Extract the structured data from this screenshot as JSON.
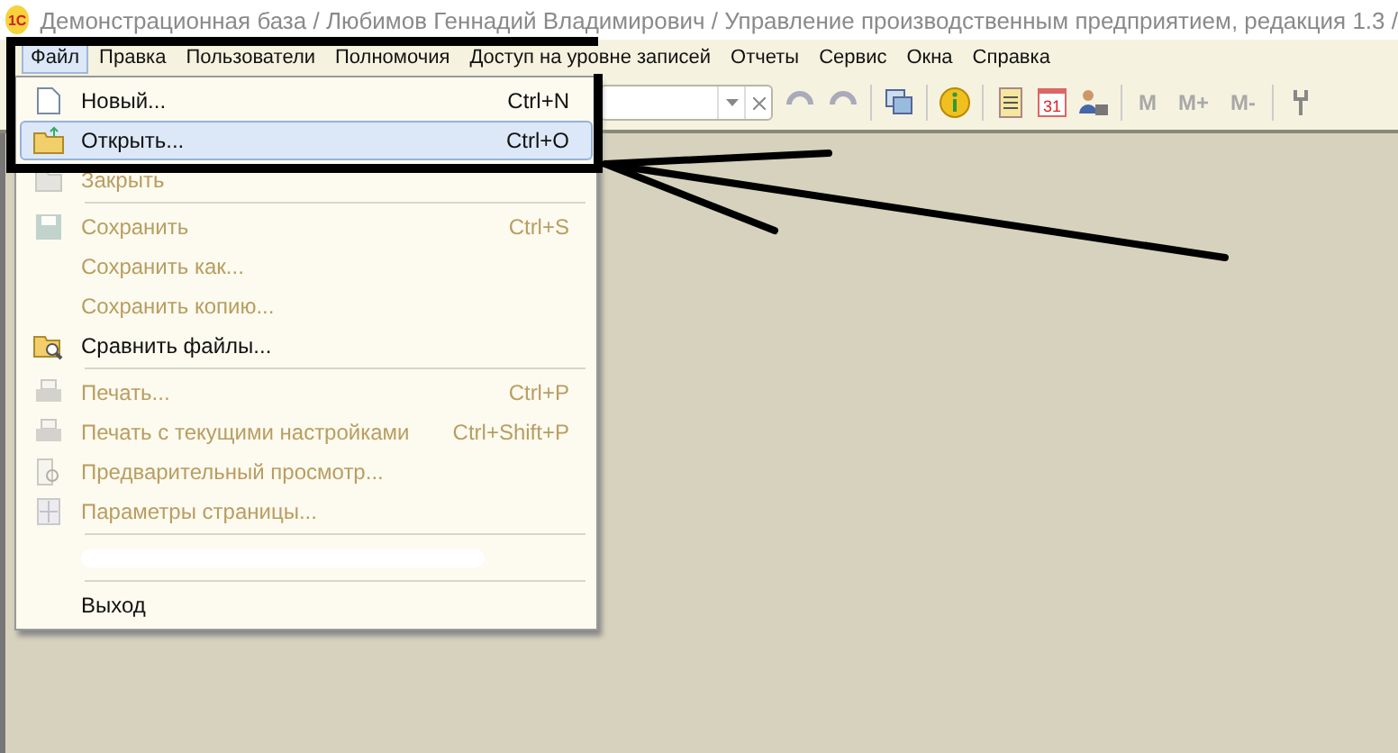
{
  "window": {
    "logo_text": "1С",
    "title": "Демонстрационная база / Любимов Геннадий Владимирович /  Управление производственным предприятием, редакция 1.3 /"
  },
  "menu_bar": [
    {
      "label": "Файл",
      "selected": true
    },
    {
      "label": "Правка",
      "selected": false
    },
    {
      "label": "Пользователи",
      "selected": false
    },
    {
      "label": "Полномочия",
      "selected": false
    },
    {
      "label": "Доступ на уровне записей",
      "selected": false
    },
    {
      "label": "Отчеты",
      "selected": false
    },
    {
      "label": "Сервис",
      "selected": false
    },
    {
      "label": "Окна",
      "selected": false
    },
    {
      "label": "Справка",
      "selected": false
    }
  ],
  "toolbar": {
    "memory_buttons": [
      "M",
      "M+",
      "M-"
    ],
    "calendar_day": "31"
  },
  "file_menu": [
    {
      "kind": "item",
      "label": "Новый...",
      "shortcut": "Ctrl+N",
      "disabled": false,
      "selected": false
    },
    {
      "kind": "item",
      "label": "Открыть...",
      "shortcut": "Ctrl+O",
      "disabled": false,
      "selected": true
    },
    {
      "kind": "item",
      "label": "Закрыть",
      "disabled": true,
      "selected": false
    },
    {
      "kind": "separator"
    },
    {
      "kind": "item",
      "label": "Сохранить",
      "shortcut": "Ctrl+S",
      "disabled": true,
      "selected": false
    },
    {
      "kind": "item",
      "label": "Сохранить как...",
      "disabled": true,
      "selected": false
    },
    {
      "kind": "item",
      "label": "Сохранить копию...",
      "disabled": true,
      "selected": false
    },
    {
      "kind": "item",
      "label": "Сравнить файлы...",
      "disabled": false,
      "selected": false
    },
    {
      "kind": "separator"
    },
    {
      "kind": "item",
      "label": "Печать...",
      "shortcut": "Ctrl+P",
      "disabled": true,
      "selected": false
    },
    {
      "kind": "item",
      "label": "Печать с текущими настройками",
      "shortcut": "Ctrl+Shift+P",
      "disabled": true,
      "selected": false
    },
    {
      "kind": "item",
      "label": "Предварительный просмотр...",
      "disabled": true,
      "selected": false
    },
    {
      "kind": "item",
      "label": "Параметры страницы...",
      "disabled": true,
      "selected": false
    },
    {
      "kind": "separator"
    },
    {
      "kind": "redacted"
    },
    {
      "kind": "separator"
    },
    {
      "kind": "item",
      "label": "Выход",
      "disabled": false,
      "selected": false
    }
  ]
}
